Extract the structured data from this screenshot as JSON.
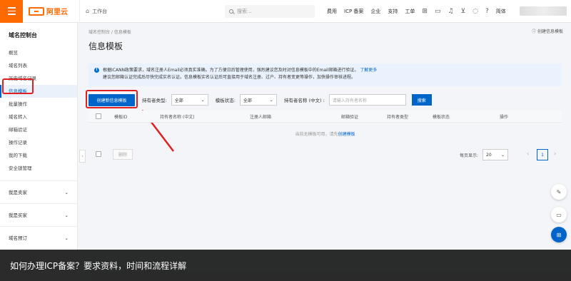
{
  "topbar": {
    "logo_text": "阿里云",
    "workbench": "工作台",
    "search_placeholder": "搜索...",
    "nav": [
      "费用",
      "ICP 备案",
      "企业",
      "支持",
      "工单"
    ],
    "lang": "简体"
  },
  "sidebar": {
    "title": "域名控制台",
    "items": [
      "概览",
      "域名列表",
      "历史域名记录",
      "信息模板",
      "批量操作",
      "域名转入",
      "邮箱验证",
      "操作记录",
      "我的下载",
      "安全锁管理"
    ],
    "groups": [
      "我是卖家",
      "我是买家",
      "域名预订"
    ]
  },
  "main": {
    "breadcrumb": "域名控制台 / 信息模板",
    "help": "创建信息模板",
    "title": "信息模板",
    "notice_line1": "根据ICANN政策要求，域名注册人Email必须真实准确。为了方便日后管理使用，强烈建议您及时对信息模板中的Email邮箱进行验证。",
    "notice_link": "了解更多",
    "notice_line2": "建议您邮箱认证完成后尽快完成实名认证。信息模板实名认证后可直接用于域名注册、过户、持有者变更等操作，加快操作审核进程。",
    "create_button": "创建新信息模板",
    "filter": {
      "holder_type_label": "持有者类型:",
      "holder_type_value": "全部",
      "status_label": "模板状态:",
      "status_value": "全部",
      "holder_name_label": "持有者名称 (中文) :",
      "holder_name_placeholder": "请输入持有者名称",
      "search_button": "搜索"
    },
    "columns": [
      "模板ID",
      "持有者名称 (中文)",
      "注册人邮箱",
      "邮箱验证",
      "持有者类型",
      "模板状态",
      "操作"
    ],
    "empty_text": "当前无模板可用，请先",
    "empty_link": "创建模板",
    "delete_button": "删除",
    "page_size_label": "每页显示:",
    "page_size": "20",
    "current_page": "1"
  },
  "caption": "如何办理ICP备案？要求资料，时间和流程详解"
}
